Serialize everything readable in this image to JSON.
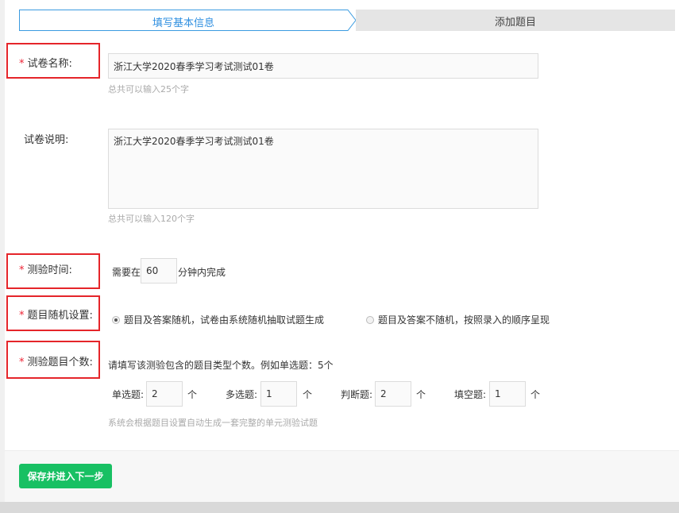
{
  "steps": [
    {
      "label": "填写基本信息",
      "active": true
    },
    {
      "label": "添加题目",
      "active": false
    }
  ],
  "form": {
    "paper_name": {
      "label": "试卷名称:",
      "required_mark": "*",
      "value": "浙江大学2020春季学习考试测试01卷",
      "hint": "总共可以输入25个字"
    },
    "paper_desc": {
      "label": "试卷说明:",
      "value": "浙江大学2020春季学习考试测试01卷",
      "hint": "总共可以输入120个字"
    },
    "duration": {
      "label": "测验时间:",
      "required_mark": "*",
      "prefix": "需要在",
      "value": "60",
      "suffix": "分钟内完成"
    },
    "random": {
      "label": "题目随机设置:",
      "required_mark": "*",
      "options": [
        {
          "label": "题目及答案随机，试卷由系统随机抽取试题生成",
          "selected": true
        },
        {
          "label": "题目及答案不随机，按照录入的顺序呈现",
          "selected": false
        }
      ]
    },
    "counts": {
      "label": "测验题目个数:",
      "required_mark": "*",
      "instruction": "请填写该测验包含的题目类型个数。例如单选题：5个",
      "items": [
        {
          "label": "单选题:",
          "value": "2",
          "unit": "个"
        },
        {
          "label": "多选题:",
          "value": "1",
          "unit": "个"
        },
        {
          "label": "判断题:",
          "value": "2",
          "unit": "个"
        },
        {
          "label": "填空题:",
          "value": "1",
          "unit": "个"
        }
      ],
      "note": "系统会根据题目设置自动生成一套完整的单元测验试题"
    }
  },
  "actions": {
    "save_label": "保存并进入下一步"
  },
  "colors": {
    "accent": "#2f8fe0",
    "primary_button": "#18c063",
    "required": "#e23333",
    "highlight_box": "#e5252a"
  }
}
